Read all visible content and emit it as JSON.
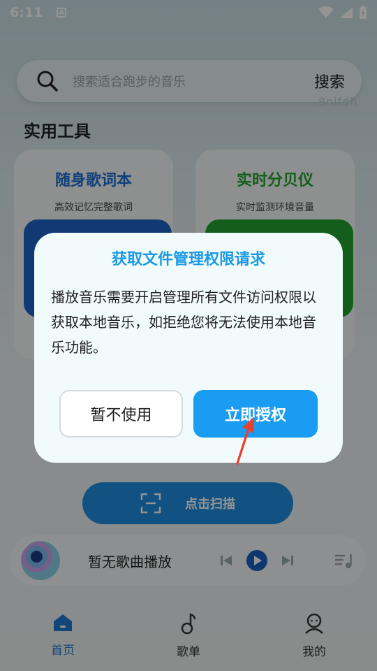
{
  "status_bar": {
    "time": "6:11",
    "a_icon": "A"
  },
  "search": {
    "placeholder": "搜索适合跑步的音乐",
    "button": "搜索"
  },
  "watermark": "8nifdh",
  "section_title": "实用工具",
  "tools": [
    {
      "title": "随身歌词本",
      "subtitle": "高效记忆完整歌词",
      "color": "#1e6fd0"
    },
    {
      "title": "实时分贝仪",
      "subtitle": "实时监测环境音量",
      "color": "#1fa32e"
    }
  ],
  "scan_button": {
    "label": "点击扫描"
  },
  "player": {
    "title": "暂无歌曲播放"
  },
  "tabs": [
    {
      "label": "首页",
      "icon": "home-icon",
      "active": true
    },
    {
      "label": "歌单",
      "icon": "music-note-icon",
      "active": false
    },
    {
      "label": "我的",
      "icon": "profile-icon",
      "active": false
    }
  ],
  "dialog": {
    "title": "获取文件管理权限请求",
    "body": "播放音乐需要开启管理所有文件访问权限以获取本地音乐，如拒绝您将无法使用本地音乐功能。",
    "cancel": "暂不使用",
    "confirm": "立即授权"
  },
  "colors": {
    "accent": "#1a9cf2",
    "dialog_title": "#1a9ae6",
    "tab_active": "#1f78d1",
    "arrow": "#e8412d"
  }
}
